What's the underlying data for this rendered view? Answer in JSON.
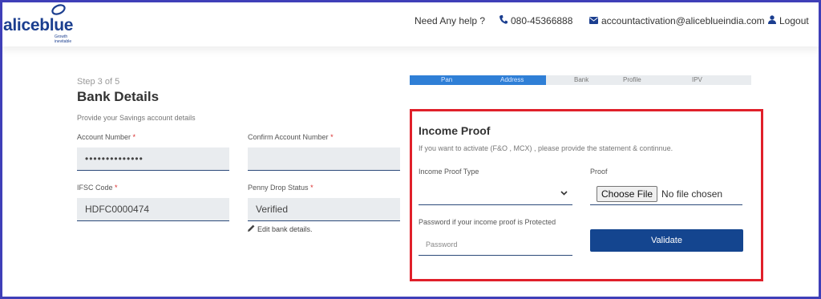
{
  "header": {
    "logo_text": "aliceblue",
    "logo_tagline": "Growth inevitable",
    "help_label": "Need Any help ?",
    "phone": "080-45366888",
    "email": "accountactivation@aliceblueindia.com",
    "logout_label": "Logout"
  },
  "form": {
    "step": "Step 3 of 5",
    "title": "Bank Details",
    "subtitle": "Provide your Savings account details",
    "account_number_label": "Account Number",
    "account_number_value": "••••••••••••••",
    "confirm_account_label": "Confirm Account Number",
    "confirm_account_value": "",
    "ifsc_label": "IFSC Code",
    "ifsc_value": "HDFC0000474",
    "penny_drop_label": "Penny Drop Status",
    "penny_drop_value": "Verified",
    "edit_bank_label": "Edit bank details.",
    "required_mark": "*"
  },
  "progress": {
    "steps": [
      "Pan",
      "Address",
      "Bank",
      "Profile",
      "IPV"
    ],
    "completed_fraction": 0.4
  },
  "income_proof": {
    "title": "Income Proof",
    "description": "If you want to activate (F&O , MCX) , please provide the statement & continnue.",
    "type_label": "Income Proof Type",
    "type_selected": "",
    "proof_label": "Proof",
    "choose_file_label": "Choose File",
    "no_file_label": "No file chosen",
    "password_label": "Password if your income proof is Protected",
    "password_placeholder": "Password",
    "validate_label": "Validate"
  },
  "colors": {
    "brand": "#1b3e8f",
    "progress_fill": "#2f7fd6",
    "highlight_border": "#e0202a",
    "button": "#14458f"
  }
}
